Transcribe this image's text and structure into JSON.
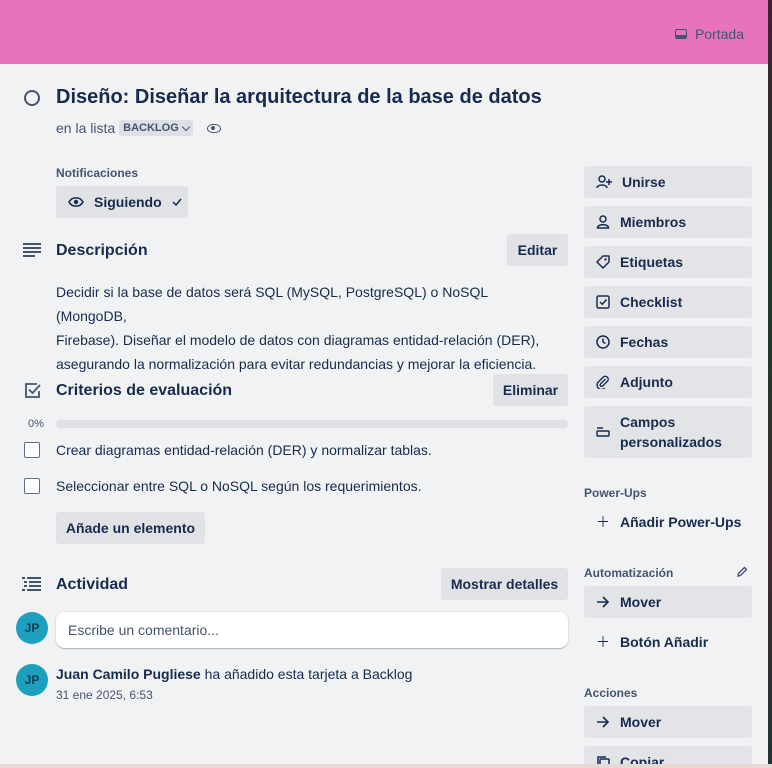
{
  "cover": {
    "label": "Portada",
    "color": "#e774bb"
  },
  "card": {
    "title": "Diseño: Diseñar la arquitectura de la base de datos",
    "in_list_prefix": "en la lista",
    "list_name": "BACKLOG"
  },
  "notifications": {
    "heading": "Notificaciones",
    "button": "Siguiendo"
  },
  "description": {
    "heading": "Descripción",
    "edit_button": "Editar",
    "lines": [
      "Decidir si la base de datos será SQL (MySQL, PostgreSQL) o NoSQL (MongoDB,",
      "Firebase). Diseñar el modelo de datos con diagramas entidad-relación (DER),",
      "asegurando la normalización para evitar redundancias y mejorar la eficiencia."
    ]
  },
  "checklist": {
    "heading": "Criterios de evaluación",
    "delete_button": "Eliminar",
    "progress_label": "0%",
    "progress": 0,
    "items": [
      {
        "text": "Crear diagramas entidad-relación (DER) y normalizar tablas.",
        "checked": false
      },
      {
        "text": "Seleccionar entre SQL o NoSQL según los requerimientos.",
        "checked": false
      }
    ],
    "add_button": "Añade un elemento"
  },
  "activity": {
    "heading": "Actividad",
    "details_button": "Mostrar detalles",
    "comment_placeholder": "Escribe un comentario...",
    "user_initials": "JP",
    "entries": [
      {
        "user": "Juan Camilo Pugliese",
        "action": "ha añadido esta tarjeta a Backlog",
        "time": "31 ene 2025, 6:53",
        "initials": "JP"
      }
    ]
  },
  "sidebar": {
    "actions": [
      {
        "label": "Unirse",
        "icon": "add-member-icon"
      },
      {
        "label": "Miembros",
        "icon": "person-icon"
      },
      {
        "label": "Etiquetas",
        "icon": "tag-icon"
      },
      {
        "label": "Checklist",
        "icon": "checkbox-icon"
      },
      {
        "label": "Fechas",
        "icon": "clock-icon"
      },
      {
        "label": "Adjunto",
        "icon": "paperclip-icon"
      },
      {
        "label_line1": "Campos",
        "label_line2": "personalizados",
        "icon": "custom-fields-icon"
      }
    ],
    "powerups": {
      "heading": "Power-Ups",
      "add": "Añadir Power-Ups"
    },
    "automation": {
      "heading": "Automatización",
      "move": "Mover",
      "add_button": "Botón Añadir"
    },
    "actions_section": {
      "heading": "Acciones",
      "move": "Mover",
      "copy": "Copiar"
    }
  }
}
